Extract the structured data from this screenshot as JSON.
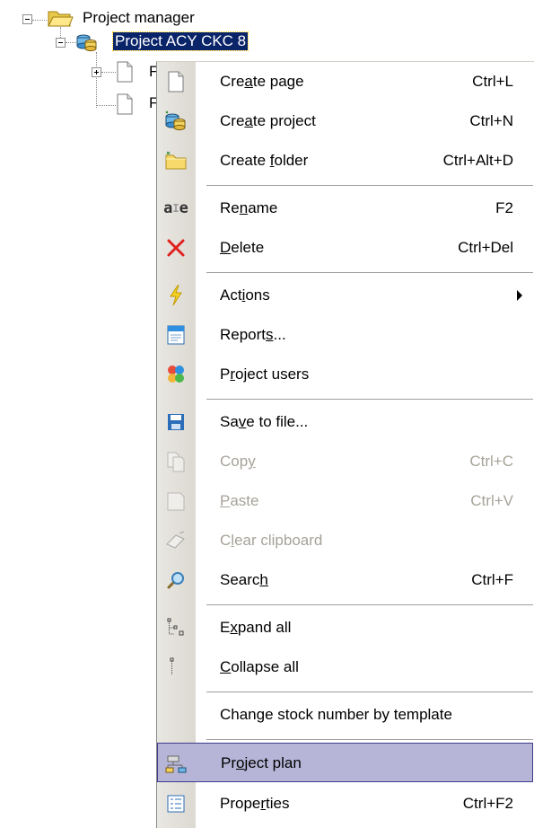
{
  "tree": {
    "root_label": "Project manager",
    "project_label": "Project ACY CKC 8",
    "child1_label": "F",
    "child2_label": "F"
  },
  "menu": {
    "items": [
      {
        "pre": "Cre",
        "acc": "a",
        "post": "te page",
        "shortcut": "Ctrl+L",
        "icon": "page-icon"
      },
      {
        "pre": "Cre",
        "acc": "a",
        "post": "te project",
        "shortcut": "Ctrl+N",
        "icon": "project-icon"
      },
      {
        "pre": "Create ",
        "acc": "f",
        "post": "older",
        "shortcut": "Ctrl+Alt+D",
        "icon": "folder-icon"
      },
      {
        "pre": "Re",
        "acc": "n",
        "post": "ame",
        "shortcut": "F2",
        "icon": "rename-icon"
      },
      {
        "pre": "",
        "acc": "D",
        "post": "elete",
        "shortcut": "Ctrl+Del",
        "icon": "delete-icon"
      },
      {
        "pre": "Act",
        "acc": "i",
        "post": "ons",
        "shortcut": "",
        "icon": "lightning-icon"
      },
      {
        "pre": "Report",
        "acc": "s",
        "post": "...",
        "shortcut": "",
        "icon": "report-icon"
      },
      {
        "pre": "P",
        "acc": "r",
        "post": "oject users",
        "shortcut": "",
        "icon": "users-icon"
      },
      {
        "pre": "Sa",
        "acc": "v",
        "post": "e to file...",
        "shortcut": "",
        "icon": "save-icon"
      },
      {
        "pre": "Cop",
        "acc": "y",
        "post": "",
        "shortcut": "Ctrl+C",
        "icon": "copy-icon"
      },
      {
        "pre": "",
        "acc": "P",
        "post": "aste",
        "shortcut": "Ctrl+V",
        "icon": "paste-icon"
      },
      {
        "pre": "C",
        "acc": "l",
        "post": "ear clipboard",
        "shortcut": "",
        "icon": "eraser-icon"
      },
      {
        "pre": "Searc",
        "acc": "h",
        "post": "",
        "shortcut": "Ctrl+F",
        "icon": "search-icon"
      },
      {
        "pre": "E",
        "acc": "x",
        "post": "pand all",
        "shortcut": "",
        "icon": "expand-tree-icon"
      },
      {
        "pre": "",
        "acc": "C",
        "post": "ollapse all",
        "shortcut": "",
        "icon": "collapse-tree-icon"
      },
      {
        "pre": "Chan",
        "acc": "g",
        "post": "e stock number by template",
        "shortcut": "",
        "icon": ""
      },
      {
        "pre": "Pr",
        "acc": "o",
        "post": "ject plan",
        "shortcut": "",
        "icon": "project-plan-icon"
      },
      {
        "pre": "Prope",
        "acc": "r",
        "post": "ties",
        "shortcut": "Ctrl+F2",
        "icon": "properties-icon"
      }
    ]
  },
  "colors": {
    "highlight": "#b6b5d7",
    "highlight_border": "#3f3d8c",
    "selection": "#0a246a",
    "disabled": "#a7a39a"
  }
}
